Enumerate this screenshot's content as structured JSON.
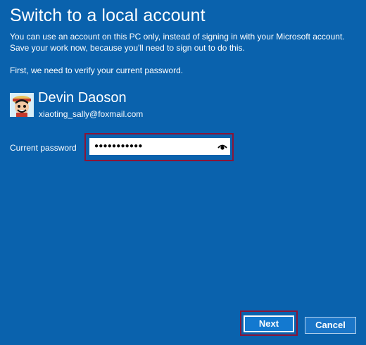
{
  "dialog": {
    "title": "Switch to a local account",
    "description": "You can use an account on this PC only, instead of signing in with your Microsoft account. Save your work now, because you'll need to sign out to do this.",
    "verify_text": "First, we need to verify your current password."
  },
  "user": {
    "name": "Devin Daoson",
    "email": "xiaoting_sally@foxmail.com"
  },
  "password": {
    "label": "Current password",
    "masked_value": "●●●●●●●●●●●",
    "reveal_icon": "eye-icon"
  },
  "buttons": {
    "next": "Next",
    "cancel": "Cancel"
  },
  "colors": {
    "background": "#0a62ad",
    "button": "#1379d0",
    "highlight": "#8a1538",
    "text": "#ffffff"
  }
}
